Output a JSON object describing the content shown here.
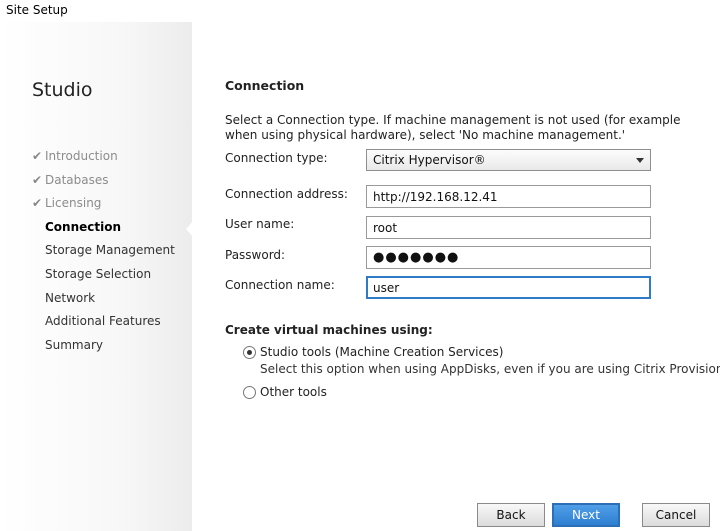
{
  "window": {
    "title": "Site Setup"
  },
  "sidebar": {
    "brand": "Studio",
    "steps": [
      {
        "label": "Introduction",
        "state": "done"
      },
      {
        "label": "Databases",
        "state": "done"
      },
      {
        "label": "Licensing",
        "state": "done"
      },
      {
        "label": "Connection",
        "state": "active"
      },
      {
        "label": "Storage Management",
        "state": "pending"
      },
      {
        "label": "Storage Selection",
        "state": "pending"
      },
      {
        "label": "Network",
        "state": "pending"
      },
      {
        "label": "Additional Features",
        "state": "pending"
      },
      {
        "label": "Summary",
        "state": "pending"
      }
    ],
    "check_glyph": "✔"
  },
  "main": {
    "heading": "Connection",
    "description": "Select a Connection type. If machine management is not used (for example when using physical hardware), select 'No machine management.'",
    "connection_type": {
      "label": "Connection type:",
      "value": "Citrix Hypervisor®"
    },
    "connection_address": {
      "label": "Connection address:",
      "value": "http://192.168.12.41"
    },
    "user_name": {
      "label": "User name:",
      "value": "root"
    },
    "password": {
      "label": "Password:",
      "value": "●●●●●●●"
    },
    "connection_name": {
      "label": "Connection name:",
      "value": "user"
    },
    "create_vms": {
      "title": "Create virtual machines using:",
      "options": [
        {
          "label": "Studio tools (Machine Creation Services)",
          "checked": true
        },
        {
          "label": "Other tools",
          "checked": false
        }
      ],
      "hint": "Select this option when using AppDisks, even if you are using Citrix Provisioning."
    }
  },
  "footer": {
    "back_label": "Back",
    "next_label": "Next",
    "cancel_label": "Cancel"
  },
  "colors": {
    "accent": "#2e7fd1",
    "focus_border": "#2f7bc8",
    "done_step": "#8c8c8c"
  }
}
